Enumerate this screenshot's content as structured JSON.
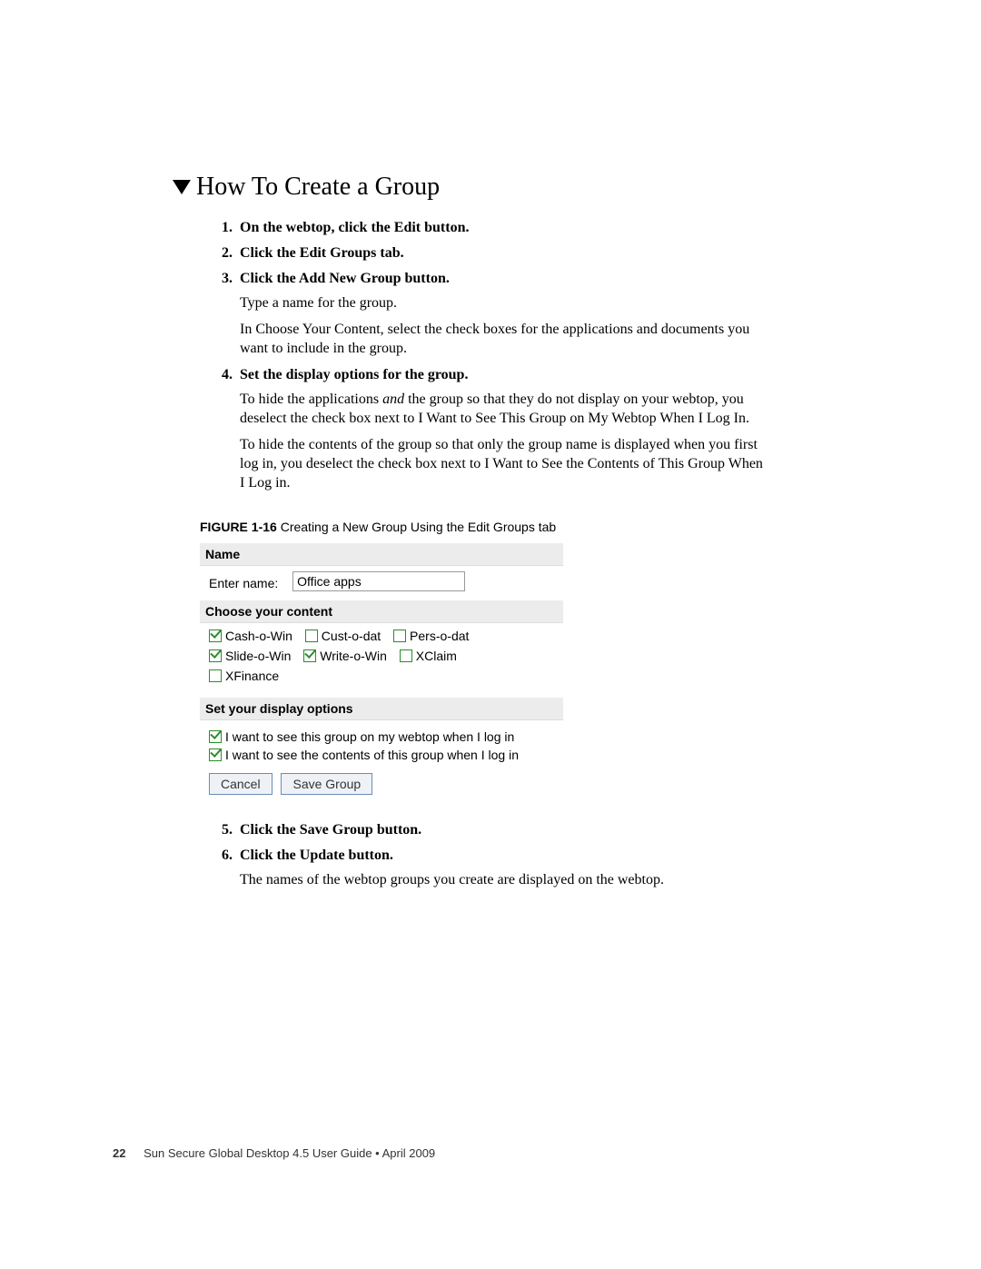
{
  "heading": "How To Create a Group",
  "steps": {
    "s1": "On the webtop, click the Edit button.",
    "s2": "Click the Edit Groups tab.",
    "s3": "Click the Add New Group button.",
    "s3_p1": "Type a name for the group.",
    "s3_p2": "In Choose Your Content, select the check boxes for the applications and documents you want to include in the group.",
    "s4": "Set the display options for the group.",
    "s4_p1a": "To hide the applications ",
    "s4_p1b": "and",
    "s4_p1c": " the group so that they do not display on your webtop, you deselect the check box next to I Want to See This Group on My Webtop When I Log In.",
    "s4_p2": "To hide the contents of the group so that only the group name is displayed when you first log in, you deselect the check box next to I Want to See the Contents of This Group When I Log in.",
    "s5": "Click the Save Group button.",
    "s6": "Click the Update button.",
    "s6_p1": "The names of the webtop groups you create are displayed on the webtop."
  },
  "figure": {
    "label": "FIGURE 1-16",
    "caption": "Creating a New Group Using the Edit Groups tab"
  },
  "ui": {
    "section_name": "Name",
    "enter_name_label": "Enter name:",
    "enter_name_value": "Office apps",
    "section_content": "Choose your content",
    "apps": [
      {
        "label": "Cash-o-Win",
        "checked": true
      },
      {
        "label": "Cust-o-dat",
        "checked": false
      },
      {
        "label": "Pers-o-dat",
        "checked": false
      },
      {
        "label": "Slide-o-Win",
        "checked": true
      },
      {
        "label": "Write-o-Win",
        "checked": true
      },
      {
        "label": "XClaim",
        "checked": false
      },
      {
        "label": "XFinance",
        "checked": false
      }
    ],
    "section_display": "Set your display options",
    "opt1": "I want to see this group on my webtop when I log in",
    "opt2": "I want to see the contents of this group when I log in",
    "cancel": "Cancel",
    "save": "Save Group"
  },
  "footer": {
    "page": "22",
    "text": "Sun Secure Global Desktop 4.5 User Guide • April 2009"
  }
}
